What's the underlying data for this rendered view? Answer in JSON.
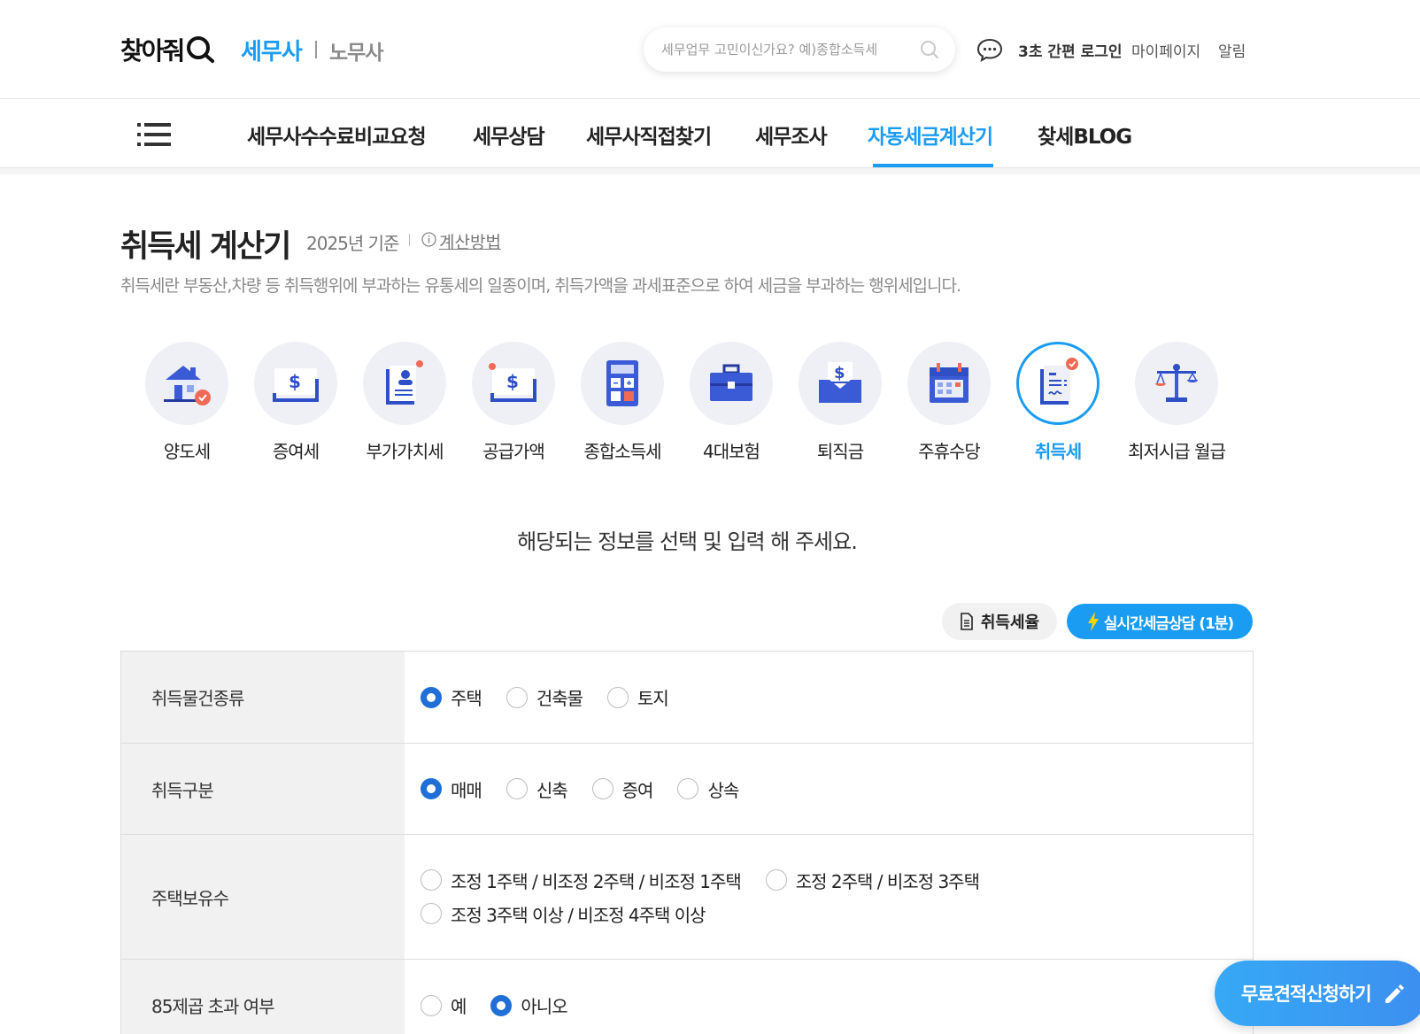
{
  "header": {
    "logo_main": "찾아줘",
    "logo_tax": "세무사",
    "logo_labor": "노무사",
    "search_placeholder": "세무업무 고민이신가요? 예)종합소득세",
    "quick_login": "3초 간편 로그인",
    "mypage": "마이페이지",
    "alarm": "알림"
  },
  "nav": {
    "items": [
      {
        "label": "세무사수수료비교요청"
      },
      {
        "label": "세무상담"
      },
      {
        "label": "세무사직접찾기"
      },
      {
        "label": "세무조사"
      },
      {
        "label": "자동세금계산기",
        "active": true
      },
      {
        "label": "찾세BLOG"
      }
    ]
  },
  "page": {
    "title": "취득세 계산기",
    "base_year": "2025년 기준",
    "calc_method": "계산방법",
    "description": "취득세란 부동산,차량 등 취득행위에 부과하는 유통세의 일종이며, 취득가액을 과세표준으로 하여 세금을 부과하는 행위세입니다.",
    "instruction": "해당되는 정보를 선택 및 입력 해 주세요."
  },
  "calculators": [
    {
      "label": "양도세",
      "icon": "house-icon"
    },
    {
      "label": "증여세",
      "icon": "money-box-icon"
    },
    {
      "label": "부가가치세",
      "icon": "document-person-icon"
    },
    {
      "label": "공급가액",
      "icon": "money-box-icon"
    },
    {
      "label": "종합소득세",
      "icon": "calculator-icon"
    },
    {
      "label": "4대보험",
      "icon": "briefcase-icon"
    },
    {
      "label": "퇴직금",
      "icon": "envelope-money-icon"
    },
    {
      "label": "주휴수당",
      "icon": "calendar-icon"
    },
    {
      "label": "취득세",
      "icon": "contract-icon",
      "active": true
    },
    {
      "label": "최저시급 월급",
      "icon": "scale-icon"
    }
  ],
  "buttons": {
    "rate": "취득세율",
    "consult": "실시간세금상담 (1분)",
    "float": "무료견적신청하기"
  },
  "form": {
    "rows": [
      {
        "label": "취득물건종류",
        "options": [
          {
            "label": "주택",
            "checked": true
          },
          {
            "label": "건축물"
          },
          {
            "label": "토지"
          }
        ]
      },
      {
        "label": "취득구분",
        "options": [
          {
            "label": "매매",
            "checked": true
          },
          {
            "label": "신축"
          },
          {
            "label": "증여"
          },
          {
            "label": "상속"
          }
        ]
      },
      {
        "label": "주택보유수",
        "options": [
          {
            "label": "조정 1주택 / 비조정 2주택 / 비조정 1주택"
          },
          {
            "label": "조정 2주택 / 비조정 3주택"
          },
          {
            "label": "조정 3주택 이상 / 비조정 4주택 이상"
          }
        ]
      },
      {
        "label": "85제곱 초과 여부",
        "options": [
          {
            "label": "예"
          },
          {
            "label": "아니오",
            "checked": true
          }
        ]
      }
    ]
  },
  "colors": {
    "accent": "#1a9cf2",
    "radio": "#1f6fd6"
  }
}
